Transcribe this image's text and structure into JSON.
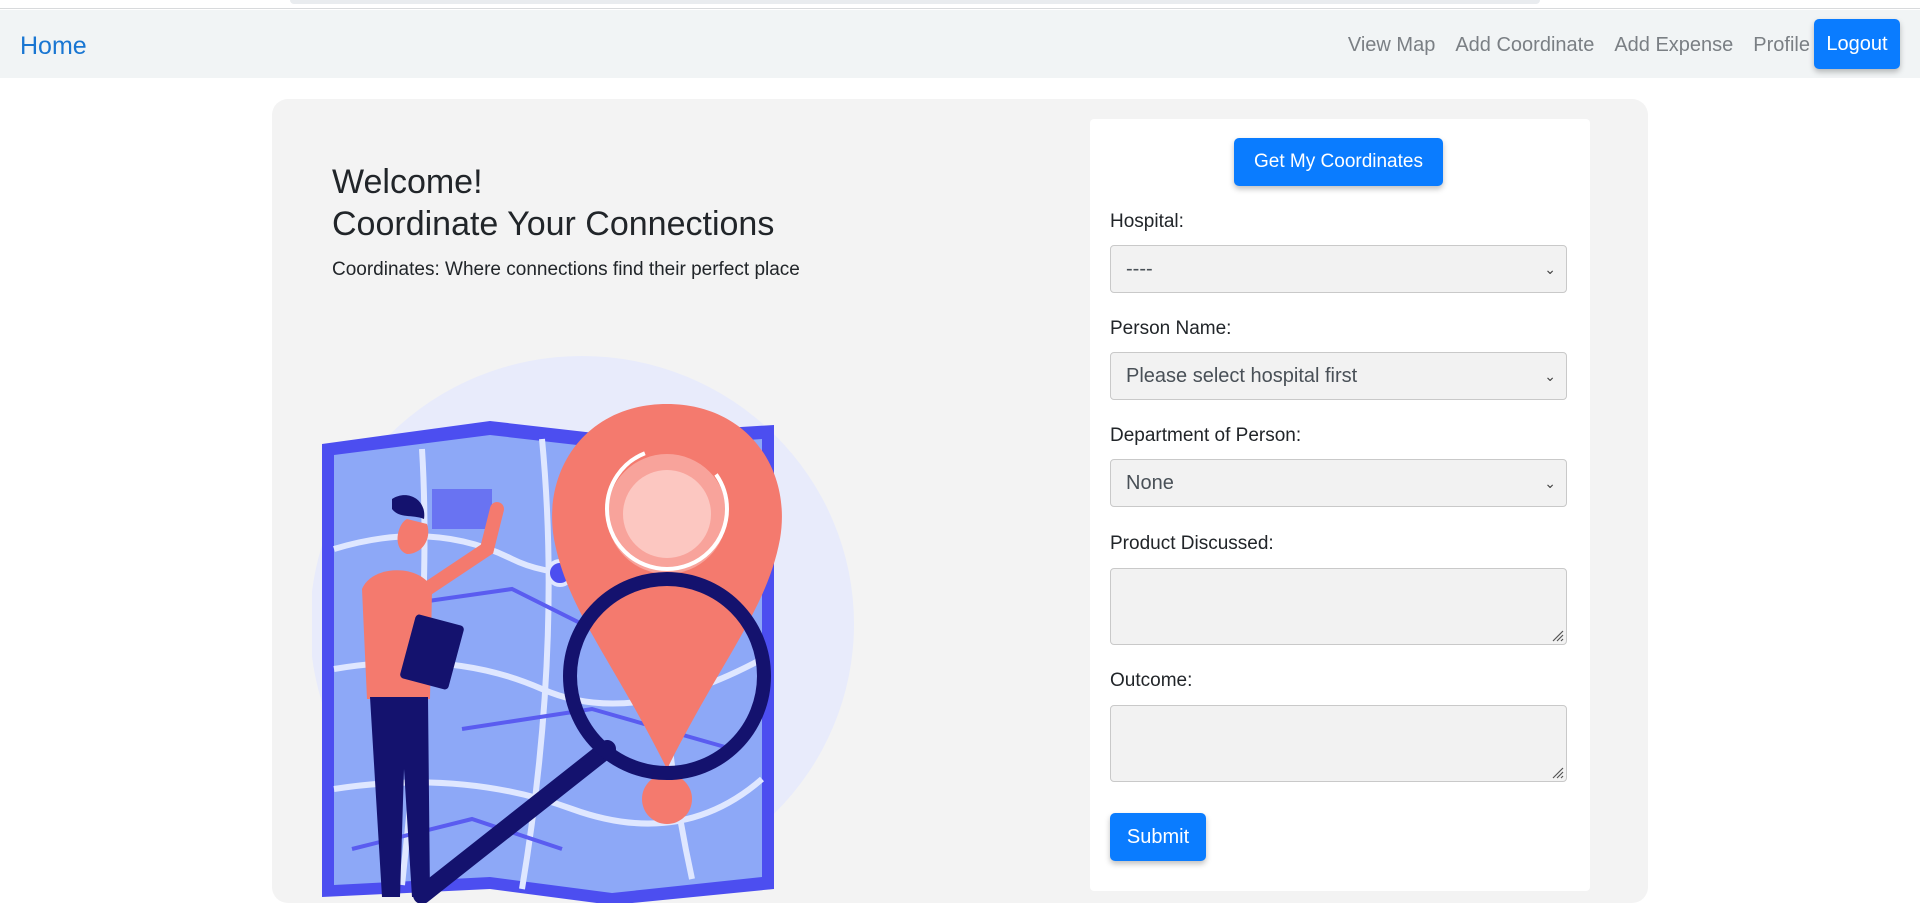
{
  "navbar": {
    "brand": "Home",
    "links": [
      "View Map",
      "Add Coordinate",
      "Add Expense",
      "Profile"
    ],
    "logout_label": "Logout"
  },
  "hero": {
    "title_line1": "Welcome!",
    "title_line2": "Coordinate Your Connections",
    "subtitle": "Coordinates: Where connections find their perfect place",
    "illustration": "map-search-illustration"
  },
  "form": {
    "get_coords_label": "Get My Coordinates",
    "hospital": {
      "label": "Hospital:",
      "value": "----"
    },
    "person_name": {
      "label": "Person Name:",
      "value": "Please select hospital first"
    },
    "department": {
      "label": "Department of Person:",
      "value": "None"
    },
    "product": {
      "label": "Product Discussed:",
      "value": ""
    },
    "outcome": {
      "label": "Outcome:",
      "value": ""
    },
    "submit_label": "Submit"
  },
  "colors": {
    "primary": "#0a7cff",
    "brand_link": "#1976d2",
    "navbar_bg": "#f1f4f5",
    "card_bg": "#f3f3f3"
  }
}
